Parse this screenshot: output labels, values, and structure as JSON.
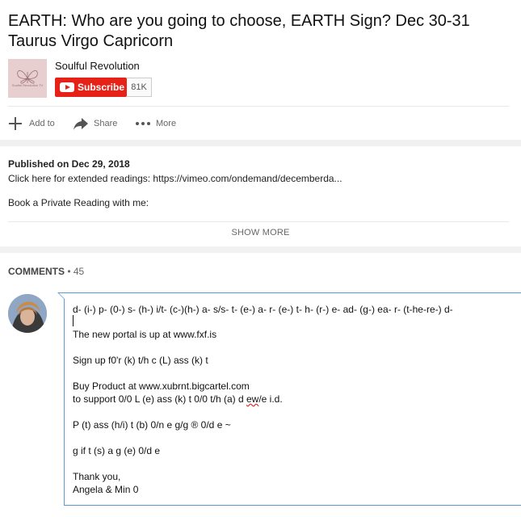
{
  "video": {
    "title": "EARTH: Who are you going to choose, EARTH Sign? Dec 30-31 Taurus Virgo Capricorn"
  },
  "channel": {
    "name": "Soulful Revolution",
    "logo_text": "Soulful Revolution TV",
    "subscribe_label": "Subscribe",
    "subscriber_count": "81K"
  },
  "actions": {
    "add_to": "Add to",
    "share": "Share",
    "more": "More"
  },
  "description": {
    "published": "Published on Dec 29, 2018",
    "line1": "Click here for extended readings: https://vimeo.com/ondemand/decemberda...",
    "line2": "Book a Private Reading with me:",
    "show_more": "SHOW MORE"
  },
  "comments": {
    "header": "COMMENTS",
    "count": "• 45",
    "draft": {
      "line1": "d- (i-) p- (0-) s- (h-) i/t-  (c-)(h-) a- s/s- t- (e-) a- r- (e-) t- h- (r-) e- ad- (g-) ea- r- (t-he-re-) d-",
      "line2": "The new portal is up at www.fxf.is",
      "line3": "Sign up f0'r (k) t/h c (L) ass (k) t",
      "line4": "Buy Product at www.xubrnt.bigcartel.com",
      "line5_prefix": "to support 0/0 L (e) ass (k) t 0/0 t/h (a) d ",
      "line5_misspelled": "ew",
      "line5_suffix": "/e i.d.",
      "line6": "P (t) ass (h/i) t (b) 0/n e g/g ® 0/d e ~",
      "line7": "g if t (s) a g (e) 0/d e",
      "line8": "Thank you,",
      "line9": "Angela & Min 0"
    }
  }
}
